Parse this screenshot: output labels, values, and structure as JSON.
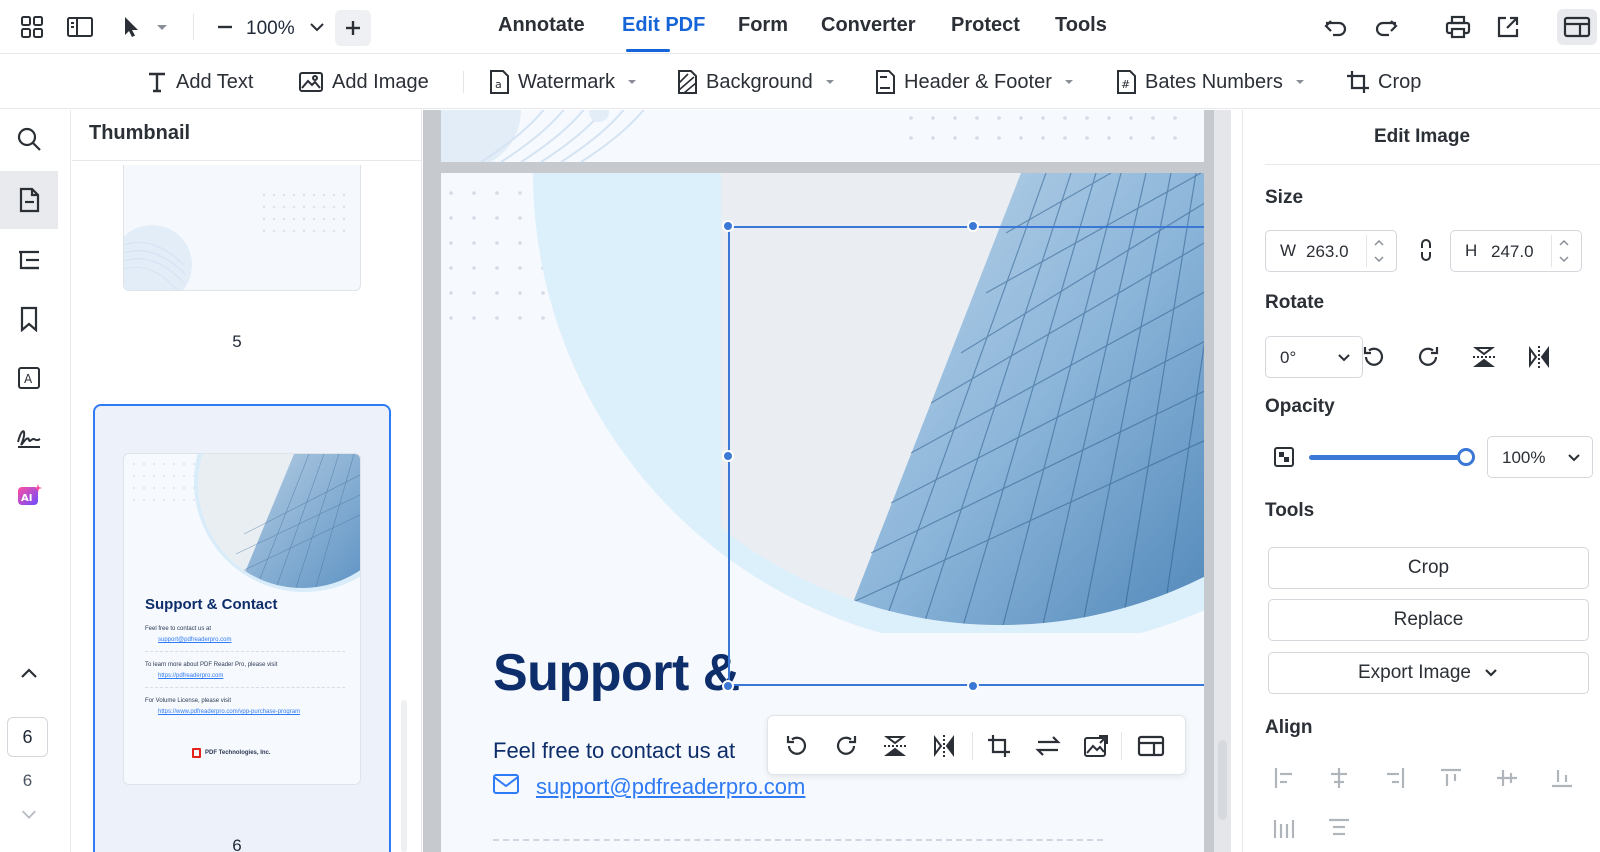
{
  "top_bar": {
    "zoom_value": "100%",
    "tabs": [
      "Annotate",
      "Edit PDF",
      "Form",
      "Converter",
      "Protect",
      "Tools"
    ],
    "active_tab": "Edit PDF"
  },
  "edit_toolbar": {
    "add_text": "Add Text",
    "add_image": "Add Image",
    "watermark": "Watermark",
    "background": "Background",
    "header_footer": "Header & Footer",
    "bates_numbers": "Bates Numbers",
    "crop": "Crop"
  },
  "left_rail": {
    "current_page": "6",
    "total_pages": "6"
  },
  "thumbnail_panel": {
    "title": "Thumbnail",
    "page5_label": "5",
    "page6_label": "6",
    "page6": {
      "heading": "Support & Contact",
      "line1": "Feel free to contact us at",
      "email": "support@pdfreaderpro.com",
      "line2": "To learn more about PDF Reader Pro,  please visit",
      "link2": "https://pdfreaderpro.com",
      "line3": "For Volume License, please visit",
      "link3": "https://www.pdfreaderpro.com/vpp-purchase-program",
      "company": "PDF Technologies, Inc."
    }
  },
  "document": {
    "heading": "Support &",
    "contact_line": "Feel free to contact us at",
    "email": "support@pdfreaderpro.com"
  },
  "right_panel": {
    "title": "Edit Image",
    "size_label": "Size",
    "width_label": "W",
    "width_value": "263.0",
    "height_label": "H",
    "height_value": "247.0",
    "rotate_label": "Rotate",
    "rotate_value": "0°",
    "opacity_label": "Opacity",
    "opacity_value": "100%",
    "opacity_level": 1.0,
    "tools_label": "Tools",
    "crop_button": "Crop",
    "replace_button": "Replace",
    "export_button": "Export Image",
    "align_label": "Align"
  },
  "colors": {
    "accent": "#1565d8",
    "selection": "#3b78d6",
    "heading_navy": "#0d2d6b",
    "link_blue": "#2f7bf5"
  }
}
